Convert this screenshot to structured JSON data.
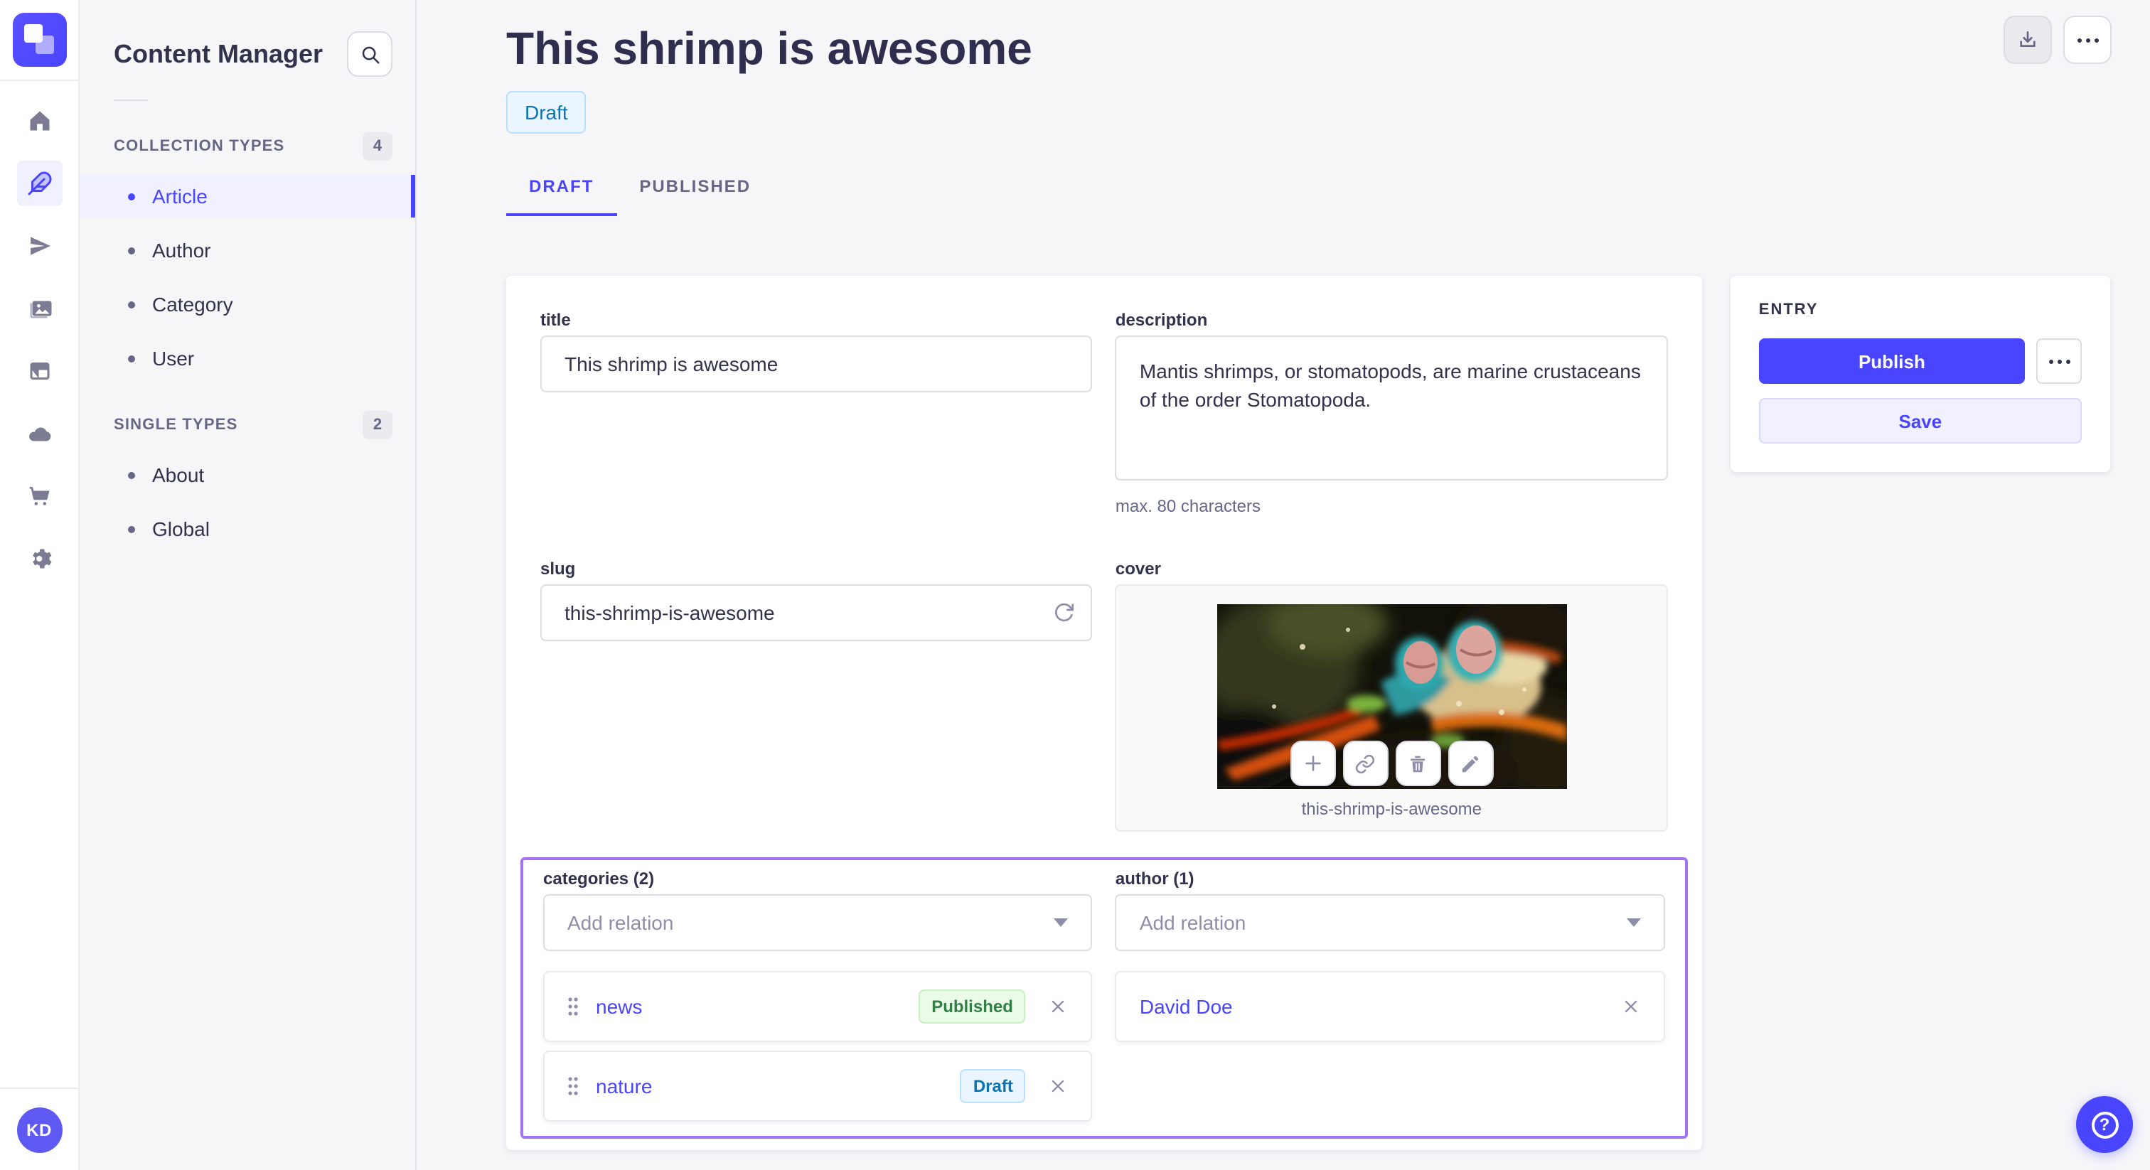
{
  "rail": {
    "logo": "strapi-logo",
    "icons": [
      "home-icon",
      "content-manager-feather-icon",
      "send-icon",
      "media-library-icon",
      "layout-icon",
      "cloud-icon",
      "cart-icon",
      "settings-gear-icon"
    ],
    "avatar_initials": "KD"
  },
  "sidebar": {
    "title": "Content Manager",
    "search_icon": "search-icon",
    "sections": [
      {
        "label": "COLLECTION TYPES",
        "count": "4",
        "items": [
          {
            "label": "Article"
          },
          {
            "label": "Author"
          },
          {
            "label": "Category"
          },
          {
            "label": "User"
          }
        ]
      },
      {
        "label": "SINGLE TYPES",
        "count": "2",
        "items": [
          {
            "label": "About"
          },
          {
            "label": "Global"
          }
        ]
      }
    ]
  },
  "header": {
    "title": "This shrimp is awesome",
    "status": "Draft",
    "tabs": [
      {
        "label": "DRAFT"
      },
      {
        "label": "PUBLISHED"
      }
    ],
    "actions": [
      "download-icon",
      "more-options-icon"
    ]
  },
  "form": {
    "title_field": {
      "label": "title",
      "value": "This shrimp is awesome"
    },
    "description_field": {
      "label": "description",
      "value": "Mantis shrimps, or stomatopods, are marine crustaceans of the order Stomatopoda.",
      "hint": "max. 80 characters"
    },
    "slug_field": {
      "label": "slug",
      "value": "this-shrimp-is-awesome",
      "icon": "regenerate-icon"
    },
    "cover_field": {
      "label": "cover",
      "filename": "this-shrimp-is-awesome",
      "action_icons": [
        "plus-icon",
        "link-icon",
        "trash-icon",
        "pencil-icon"
      ]
    },
    "categories_field": {
      "label": "categories (2)",
      "placeholder": "Add relation",
      "relations": [
        {
          "name": "news",
          "status": "Published"
        },
        {
          "name": "nature",
          "status": "Draft"
        }
      ]
    },
    "author_field": {
      "label": "author (1)",
      "placeholder": "Add relation",
      "relations": [
        {
          "name": "David Doe"
        }
      ]
    }
  },
  "entry": {
    "title": "ENTRY",
    "publish": "Publish",
    "save": "Save",
    "more_icon": "more-options-icon"
  },
  "fab": {
    "icon": "help-icon",
    "glyph": "?"
  },
  "colors": {
    "primary": "#4945ff",
    "primary_light": "#f0f0ff",
    "focus_outline": "#a373f2",
    "published_bg": "#eafbe7",
    "published_border": "#c6f0c2",
    "published_text": "#328048",
    "draft_bg": "#eaf5ff",
    "draft_border": "#b8e1ff",
    "draft_text": "#0c75af",
    "text_dark": "#32324d",
    "text_muted": "#666687",
    "border": "#dcdce4",
    "canvas": "#f6f6f9"
  }
}
